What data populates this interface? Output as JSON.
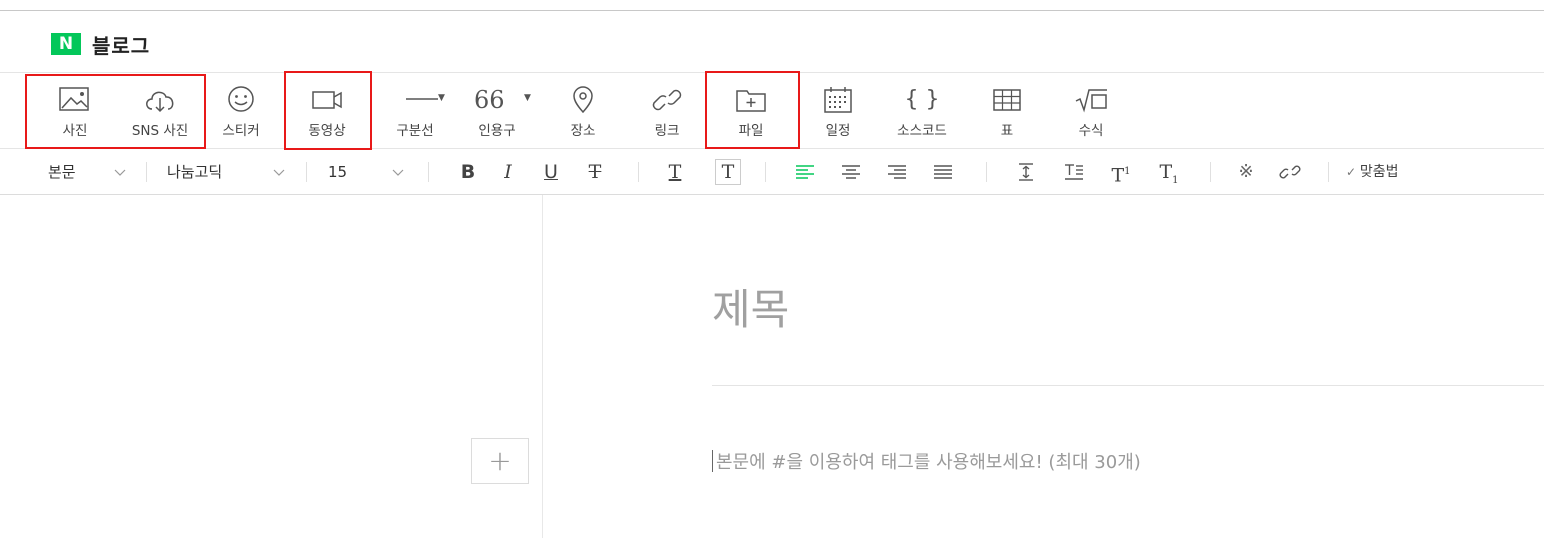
{
  "header": {
    "logo_letter": "N",
    "title": "블로그"
  },
  "toolbar": {
    "photo": "사진",
    "sns_photo": "SNS 사진",
    "sticker": "스티커",
    "video": "동영상",
    "divider": "구분선",
    "quote": "인용구",
    "quote_glyph": "66",
    "place": "장소",
    "link": "링크",
    "file": "파일",
    "schedule": "일정",
    "source_code": "소스코드",
    "table": "표",
    "formula": "수식"
  },
  "format_bar": {
    "paragraph_style": "본문",
    "font_family": "나눔고딕",
    "font_size": "15",
    "bold": "B",
    "italic": "I",
    "underline": "U",
    "strike": "T",
    "font_color": "T",
    "bg_color": "T",
    "special_char": "※",
    "spellcheck": "맞춤법"
  },
  "editor": {
    "title_placeholder": "제목",
    "body_placeholder": "본문에 #을 이용하여 태그를 사용해보세요! (최대 30개)",
    "add_button": "+"
  },
  "colors": {
    "brand": "#03c75a",
    "highlight": "#e81919",
    "align_active": "#03c75a"
  }
}
